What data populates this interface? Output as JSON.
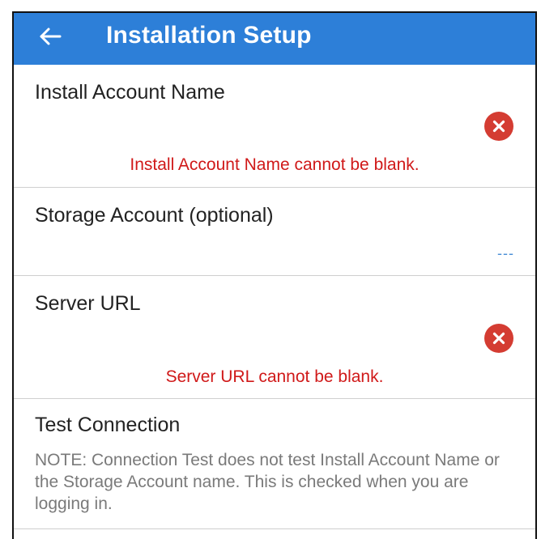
{
  "appbar": {
    "title": "Installation Setup",
    "back_icon": "arrow-left-icon",
    "color": "#2d7fd8"
  },
  "fields": {
    "install_account": {
      "label": "Install Account Name",
      "error": "Install Account Name cannot be blank.",
      "error_icon": "error-x-icon"
    },
    "storage_account": {
      "label": "Storage Account (optional)",
      "value": "---"
    },
    "server_url": {
      "label": "Server URL",
      "error": "Server URL cannot be blank.",
      "error_icon": "error-x-icon"
    },
    "test_connection": {
      "label": "Test Connection",
      "note": "NOTE: Connection Test does not test Install Account Name or the Storage Account name. This is checked when you are logging in."
    }
  },
  "colors": {
    "error_text": "#d01919",
    "error_icon_bg": "#d43c32",
    "link_blue": "#4a8fd6"
  }
}
